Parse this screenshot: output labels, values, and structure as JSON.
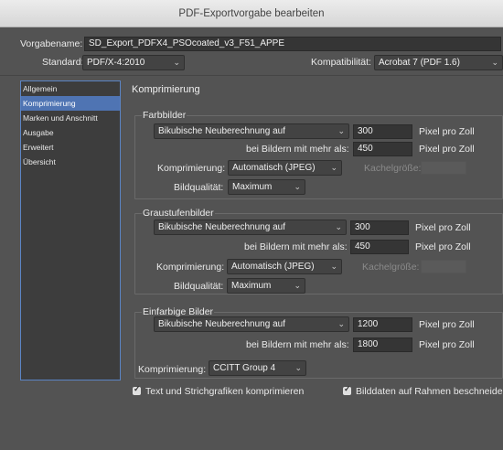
{
  "window": {
    "title": "PDF-Exportvorgabe bearbeiten"
  },
  "header": {
    "preset_label": "Vorgabename:",
    "preset_value": "SD_Export_PDFX4_PSOcoated_v3_F51_APPE",
    "standard_label": "Standard:",
    "standard_value": "PDF/X-4:2010",
    "compat_label": "Kompatibilität:",
    "compat_value": "Acrobat 7 (PDF 1.6)"
  },
  "sidebar": {
    "items": [
      {
        "label": "Allgemein"
      },
      {
        "label": "Komprimierung"
      },
      {
        "label": "Marken und Anschnitt"
      },
      {
        "label": "Ausgabe"
      },
      {
        "label": "Erweitert"
      },
      {
        "label": "Übersicht"
      }
    ]
  },
  "main": {
    "section_title": "Komprimierung",
    "color": {
      "title": "Farbbilder",
      "method": "Bikubische Neuberechnung auf",
      "resolution": "300",
      "unit": "Pixel pro Zoll",
      "threshold_label": "bei Bildern mit mehr als:",
      "threshold": "450",
      "threshold_unit": "Pixel pro Zoll",
      "compression_label": "Komprimierung:",
      "compression": "Automatisch (JPEG)",
      "tile_label": "Kachelgröße:",
      "quality_label": "Bildqualität:",
      "quality": "Maximum"
    },
    "gray": {
      "title": "Graustufenbilder",
      "method": "Bikubische Neuberechnung auf",
      "resolution": "300",
      "unit": "Pixel pro Zoll",
      "threshold_label": "bei Bildern mit mehr als:",
      "threshold": "450",
      "threshold_unit": "Pixel pro Zoll",
      "compression_label": "Komprimierung:",
      "compression": "Automatisch (JPEG)",
      "tile_label": "Kachelgröße:",
      "quality_label": "Bildqualität:",
      "quality": "Maximum"
    },
    "mono": {
      "title": "Einfarbige Bilder",
      "method": "Bikubische Neuberechnung auf",
      "resolution": "1200",
      "unit": "Pixel pro Zoll",
      "threshold_label": "bei Bildern mit mehr als:",
      "threshold": "1800",
      "threshold_unit": "Pixel pro Zoll",
      "compression_label": "Komprimierung:",
      "compression": "CCITT Group 4"
    },
    "options": {
      "text_art": "Text und Strichgrafiken komprimieren",
      "crop": "Bilddaten auf Rahmen beschneiden"
    }
  },
  "icons": {
    "chevron": "chevron-down-icon",
    "checkbox": "checkmark-icon"
  },
  "colors": {
    "background": "#535353",
    "selection": "#4f74b3",
    "field": "#353535"
  }
}
